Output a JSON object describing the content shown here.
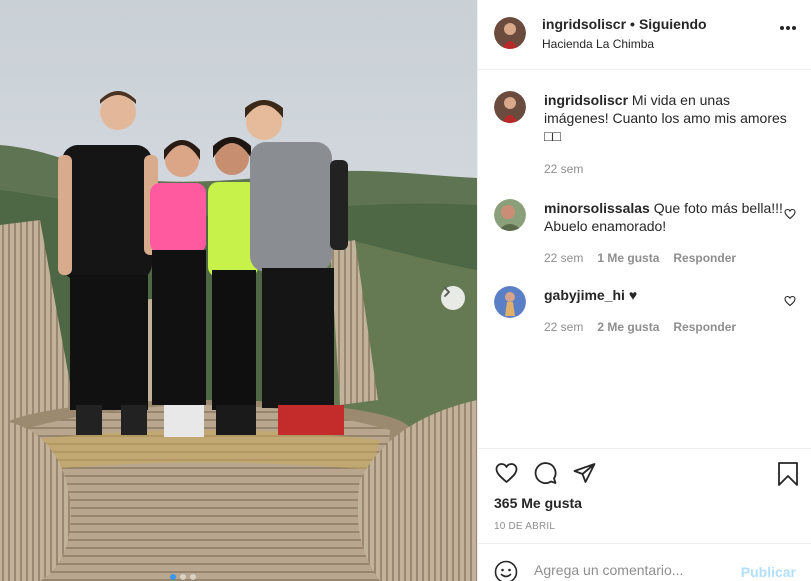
{
  "post": {
    "photo_description": "",
    "dots": 3
  },
  "header": {
    "username": "ingridsoliscr",
    "separator": "•",
    "follow_status": "Siguiendo",
    "location": "Hacienda La Chimba",
    "more_icon": "more-horizontal-icon"
  },
  "caption": {
    "username": "ingridsoliscr",
    "text": "Mi vida en unas imágenes! Cuanto los amo mis amores □□",
    "time": "22 sem"
  },
  "comments": [
    {
      "username": "minorsolissalas",
      "text": "Que foto más bella!!! Abuelo enamorado!",
      "time": "22 sem",
      "likes": "1 Me gusta",
      "reply": "Responder"
    },
    {
      "username": "gabyjime_hi",
      "text": "♥",
      "time": "22 sem",
      "likes": "2 Me gusta",
      "reply": "Responder"
    }
  ],
  "actions": {
    "likes": "365 Me gusta",
    "date": "10 DE ABRIL",
    "comment_placeholder": "Agrega un comentario...",
    "post_label": "Publicar"
  },
  "colors": {
    "accent": "#3897f0",
    "post_disabled": "#b2dffc",
    "muted": "#8e8e8e",
    "text": "#262626"
  }
}
